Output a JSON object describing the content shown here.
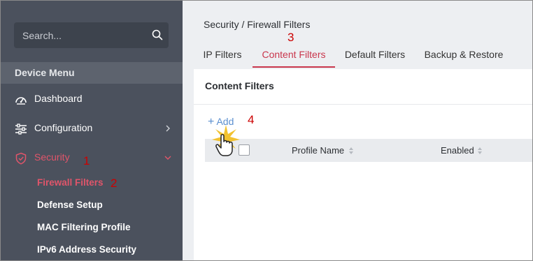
{
  "sidebar": {
    "search_placeholder": "Search...",
    "section_title": "Device Menu",
    "items": [
      {
        "label": "Dashboard",
        "icon": "dashboard-icon"
      },
      {
        "label": "Configuration",
        "icon": "sliders-icon"
      },
      {
        "label": "Security",
        "icon": "shield-icon",
        "active": true
      }
    ],
    "sub_items": [
      {
        "label": "Firewall Filters",
        "active": true
      },
      {
        "label": "Defense Setup"
      },
      {
        "label": "MAC Filtering Profile"
      },
      {
        "label": "IPv6 Address Security"
      }
    ]
  },
  "main": {
    "breadcrumb": "Security / Firewall Filters",
    "tabs": [
      {
        "label": "IP Filters"
      },
      {
        "label": "Content Filters",
        "active": true
      },
      {
        "label": "Default Filters"
      },
      {
        "label": "Backup & Restore"
      }
    ],
    "card": {
      "title": "Content Filters",
      "add_label": "Add",
      "columns": [
        "Profile Name",
        "Enabled"
      ]
    }
  },
  "annotations": [
    "1",
    "2",
    "3",
    "4"
  ],
  "colors": {
    "sidebar_bg": "#4b515d",
    "accent": "#c9364c",
    "link": "#5b8fcf",
    "annotation": "#cc0000"
  }
}
